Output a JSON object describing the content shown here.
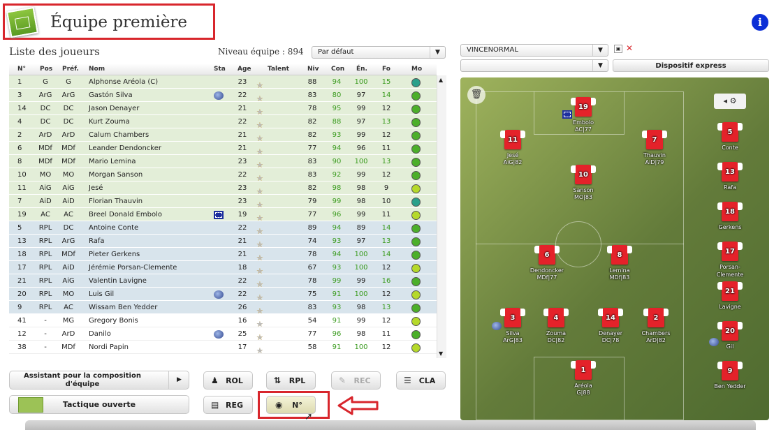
{
  "header": {
    "title": "Équipe première",
    "info_icon": "info-icon"
  },
  "list": {
    "title": "Liste des joueurs",
    "level_text": "Niveau équipe : 894",
    "sort_select": "Par défaut"
  },
  "columns": [
    "N°",
    "Pos",
    "Préf.",
    "Nom",
    "Sta",
    "Age",
    "Talent",
    "Niv",
    "Con",
    "Én.",
    "Fo",
    "Mo"
  ],
  "players": [
    {
      "num": "1",
      "pos": "G",
      "pref": "G",
      "name": "Alphonse Aréola (C)",
      "sta": "",
      "age": "23",
      "stars": 4,
      "niv": "88",
      "con": "94",
      "en": "100",
      "fo": "15",
      "mo": "#2aa08a",
      "bg": "g"
    },
    {
      "num": "3",
      "pos": "ArG",
      "pref": "ArG",
      "name": "Gastón Silva",
      "sta": "globe",
      "age": "22",
      "stars": 4,
      "niv": "83",
      "con": "80",
      "en": "97",
      "fo": "14",
      "mo": "#4caf2a",
      "bg": "g"
    },
    {
      "num": "14",
      "pos": "DC",
      "pref": "DC",
      "name": "Jason Denayer",
      "sta": "",
      "age": "21",
      "stars": 4,
      "niv": "78",
      "con": "95",
      "en": "99",
      "fo": "12",
      "mo": "#4caf2a",
      "bg": "g"
    },
    {
      "num": "4",
      "pos": "DC",
      "pref": "DC",
      "name": "Kurt Zouma",
      "sta": "",
      "age": "22",
      "stars": 4,
      "niv": "82",
      "con": "88",
      "en": "97",
      "fo": "13",
      "mo": "#4caf2a",
      "bg": "g"
    },
    {
      "num": "2",
      "pos": "ArD",
      "pref": "ArD",
      "name": "Calum Chambers",
      "sta": "",
      "age": "21",
      "stars": 4,
      "niv": "82",
      "con": "93",
      "en": "99",
      "fo": "12",
      "mo": "#4caf2a",
      "bg": "g"
    },
    {
      "num": "6",
      "pos": "MDf",
      "pref": "MDf",
      "name": "Leander Dendoncker",
      "sta": "",
      "age": "21",
      "stars": 4,
      "niv": "77",
      "con": "94",
      "en": "96",
      "fo": "11",
      "mo": "#4caf2a",
      "bg": "g"
    },
    {
      "num": "8",
      "pos": "MDf",
      "pref": "MDf",
      "name": "Mario Lemina",
      "sta": "",
      "age": "23",
      "stars": 4,
      "niv": "83",
      "con": "90",
      "en": "100",
      "fo": "13",
      "mo": "#4caf2a",
      "bg": "g"
    },
    {
      "num": "10",
      "pos": "MO",
      "pref": "MO",
      "name": "Morgan Sanson",
      "sta": "",
      "age": "22",
      "stars": 4,
      "niv": "83",
      "con": "92",
      "en": "99",
      "fo": "12",
      "mo": "#4caf2a",
      "bg": "g"
    },
    {
      "num": "11",
      "pos": "AiG",
      "pref": "AiG",
      "name": "Jesé",
      "sta": "",
      "age": "23",
      "stars": 4,
      "niv": "82",
      "con": "98",
      "en": "98",
      "fo": "9",
      "mo": "#b5d92a",
      "bg": "g"
    },
    {
      "num": "7",
      "pos": "AiD",
      "pref": "AiD",
      "name": "Florian Thauvin",
      "sta": "",
      "age": "23",
      "stars": 4,
      "niv": "79",
      "con": "99",
      "en": "98",
      "fo": "10",
      "mo": "#2aa08a",
      "bg": "g"
    },
    {
      "num": "19",
      "pos": "AC",
      "pref": "AC",
      "name": "Breel Donald Embolo",
      "sta": "eu",
      "age": "19",
      "stars": 4,
      "niv": "77",
      "con": "96",
      "en": "99",
      "fo": "11",
      "mo": "#b5d92a",
      "bg": "g"
    },
    {
      "num": "5",
      "pos": "RPL",
      "pref": "DC",
      "name": "Antoine Conte",
      "sta": "",
      "age": "22",
      "stars": 4,
      "niv": "89",
      "con": "94",
      "en": "89",
      "fo": "14",
      "mo": "#4caf2a",
      "bg": "b"
    },
    {
      "num": "13",
      "pos": "RPL",
      "pref": "ArG",
      "name": "Rafa",
      "sta": "",
      "age": "21",
      "stars": 4,
      "niv": "74",
      "con": "93",
      "en": "97",
      "fo": "13",
      "mo": "#4caf2a",
      "bg": "b"
    },
    {
      "num": "18",
      "pos": "RPL",
      "pref": "MDf",
      "name": "Pieter Gerkens",
      "sta": "",
      "age": "21",
      "stars": 4,
      "niv": "78",
      "con": "94",
      "en": "100",
      "fo": "14",
      "mo": "#4caf2a",
      "bg": "b"
    },
    {
      "num": "17",
      "pos": "RPL",
      "pref": "AiD",
      "name": "Jérémie Porsan-Clemente",
      "sta": "",
      "age": "18",
      "stars": 4,
      "niv": "67",
      "con": "93",
      "en": "100",
      "fo": "12",
      "mo": "#b5d92a",
      "bg": "b"
    },
    {
      "num": "21",
      "pos": "RPL",
      "pref": "AiG",
      "name": "Valentin Lavigne",
      "sta": "",
      "age": "22",
      "stars": 4,
      "niv": "78",
      "con": "99",
      "en": "99",
      "fo": "16",
      "mo": "#4caf2a",
      "bg": "b"
    },
    {
      "num": "20",
      "pos": "RPL",
      "pref": "MO",
      "name": "Luis Gil",
      "sta": "globe",
      "age": "22",
      "stars": 4,
      "niv": "75",
      "con": "91",
      "en": "100",
      "fo": "12",
      "mo": "#b5d92a",
      "bg": "b"
    },
    {
      "num": "9",
      "pos": "RPL",
      "pref": "AC",
      "name": "Wissam Ben Yedder",
      "sta": "",
      "age": "26",
      "stars": 4,
      "niv": "83",
      "con": "93",
      "en": "98",
      "fo": "13",
      "mo": "#4caf2a",
      "bg": "b"
    },
    {
      "num": "41",
      "pos": "-",
      "pref": "MG",
      "name": "Gregory Bonis",
      "sta": "",
      "age": "16",
      "stars": 3,
      "niv": "54",
      "con": "91",
      "en": "99",
      "fo": "12",
      "mo": "#b5d92a",
      "bg": "w"
    },
    {
      "num": "12",
      "pos": "-",
      "pref": "ArD",
      "name": "Danilo",
      "sta": "globe",
      "age": "25",
      "stars": 4,
      "niv": "77",
      "con": "96",
      "en": "98",
      "fo": "11",
      "mo": "#4caf2a",
      "bg": "w"
    },
    {
      "num": "38",
      "pos": "-",
      "pref": "MDf",
      "name": "Nordi Papin",
      "sta": "",
      "age": "17",
      "stars": 3,
      "niv": "58",
      "con": "91",
      "en": "100",
      "fo": "12",
      "mo": "#b5d92a",
      "bg": "w"
    }
  ],
  "tactics": {
    "profile_select": "VINCENORMAL",
    "second_select": "",
    "express_button": "Dispositif express"
  },
  "buttons": {
    "assistant": "Assistant pour la composition d'équipe",
    "tactic": "Tactique ouverte",
    "rol": "ROL",
    "rpl": "RPL",
    "rec": "REC",
    "cla": "CLA",
    "reg": "REG",
    "num": "N°"
  },
  "field_players": [
    {
      "num": "19",
      "name": "Embolo",
      "sub": "AC|77"
    },
    {
      "num": "11",
      "name": "Jesé",
      "sub": "AiG|82"
    },
    {
      "num": "7",
      "name": "Thauvin",
      "sub": "AiD|79"
    },
    {
      "num": "10",
      "name": "Sanson",
      "sub": "MO|83"
    },
    {
      "num": "6",
      "name": "Dendoncker",
      "sub": "MDf|77"
    },
    {
      "num": "8",
      "name": "Lemina",
      "sub": "MDf|83"
    },
    {
      "num": "3",
      "name": "Silva",
      "sub": "ArG|83"
    },
    {
      "num": "4",
      "name": "Zouma",
      "sub": "DC|82"
    },
    {
      "num": "14",
      "name": "Denayer",
      "sub": "DC|78"
    },
    {
      "num": "2",
      "name": "Chambers",
      "sub": "ArD|82"
    },
    {
      "num": "1",
      "name": "Aréola",
      "sub": "G|88"
    }
  ],
  "bench": [
    {
      "num": "5",
      "name": "Conte"
    },
    {
      "num": "13",
      "name": "Rafa"
    },
    {
      "num": "18",
      "name": "Gerkens"
    },
    {
      "num": "17",
      "name": "Porsan-Clemente"
    },
    {
      "num": "21",
      "name": "Lavigne"
    },
    {
      "num": "20",
      "name": "Gil"
    },
    {
      "num": "9",
      "name": "Ben Yedder"
    }
  ],
  "colors": {
    "highlight": "#d8262c",
    "starter_row": "#e3eed8",
    "sub_row": "#d8e4ec",
    "shirt": "#e4222a"
  }
}
